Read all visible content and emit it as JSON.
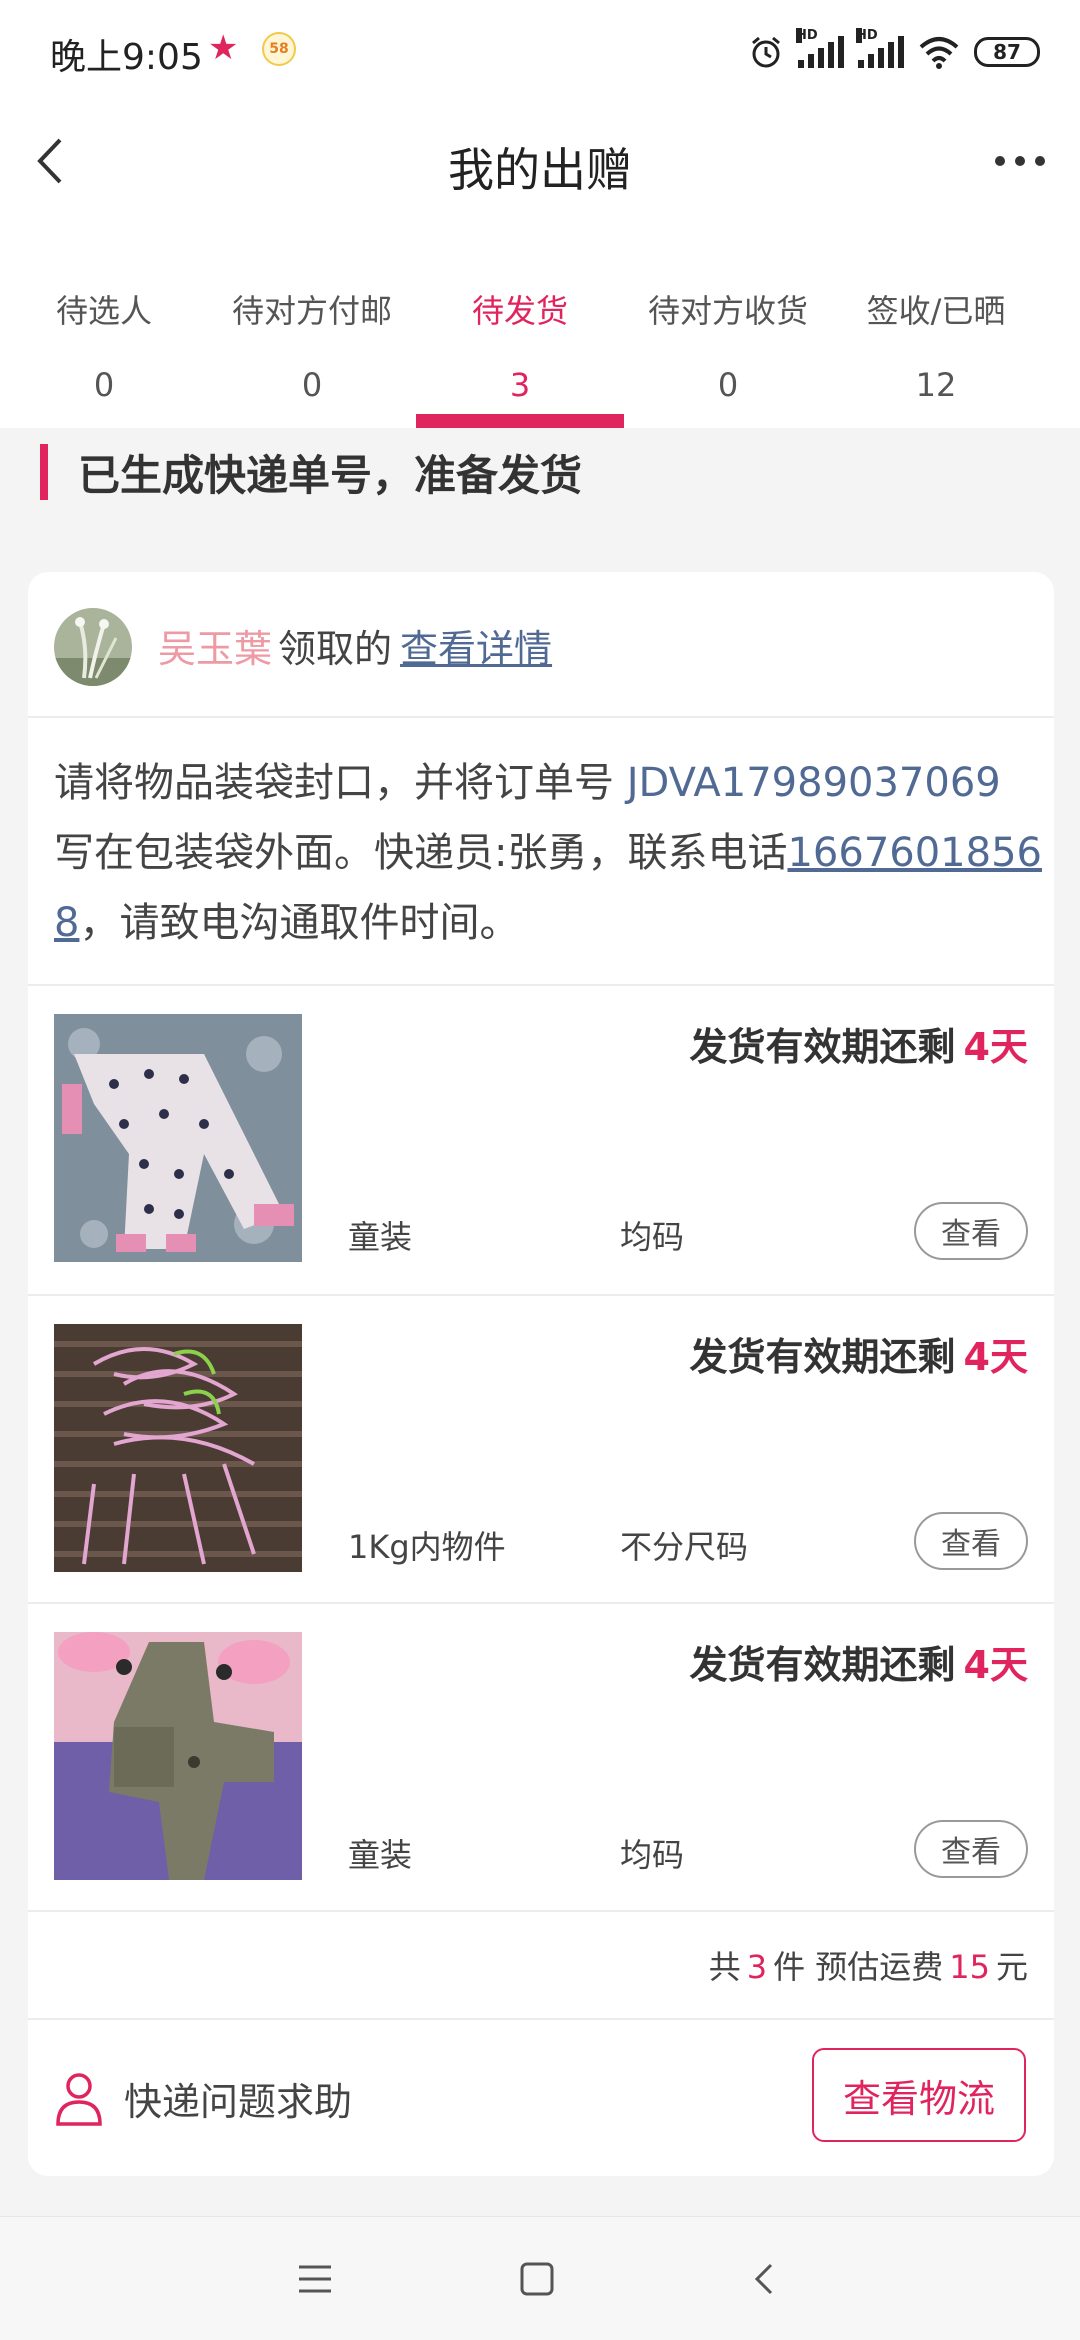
{
  "status_bar": {
    "time": "晚上9:05",
    "star": "★",
    "app_badge": "58",
    "hd1": "HD",
    "hd2": "HD",
    "battery": "87"
  },
  "header": {
    "title": "我的出赠"
  },
  "tabs": [
    {
      "label": "待选人",
      "count": "0"
    },
    {
      "label": "待对方付邮",
      "count": "0"
    },
    {
      "label": "待发货",
      "count": "3"
    },
    {
      "label": "待对方收货",
      "count": "0"
    },
    {
      "label": "签收/已晒",
      "count": "12"
    }
  ],
  "active_tab_index": 2,
  "section": {
    "heading": "已生成快递单号，准备发货"
  },
  "card": {
    "receiver": {
      "name": "吴玉葉",
      "action": "领取的",
      "detail_link": "查看详情"
    },
    "instruction": {
      "part1": "请将物品装袋封口，并将订单号 ",
      "order_no": "JDVA17989037069",
      "part2": " 写在包装袋外面。快递员:张勇，联系电话",
      "phone": "16676018568",
      "part3": "，请致电沟通取件时间。"
    },
    "items": [
      {
        "deadline": "发货有效期还剩",
        "days": "4天",
        "category": "童装",
        "size": "均码",
        "view": "查看"
      },
      {
        "deadline": "发货有效期还剩",
        "days": "4天",
        "category": "1Kg内物件",
        "size": "不分尺码",
        "view": "查看"
      },
      {
        "deadline": "发货有效期还剩",
        "days": "4天",
        "category": "童装",
        "size": "均码",
        "view": "查看"
      }
    ],
    "summary": {
      "prefix": "共",
      "count": "3",
      "mid": "件 预估运费",
      "fee": "15",
      "unit": "元"
    },
    "help_text": "快递问题求助",
    "logistics_button": "查看物流"
  },
  "colors": {
    "accent": "#e0245e",
    "link": "#516a94",
    "receiver_name": "#ee9aa5"
  },
  "icons": {
    "back": "back-arrow-icon",
    "more": "more-dots-icon",
    "help": "person-icon"
  }
}
